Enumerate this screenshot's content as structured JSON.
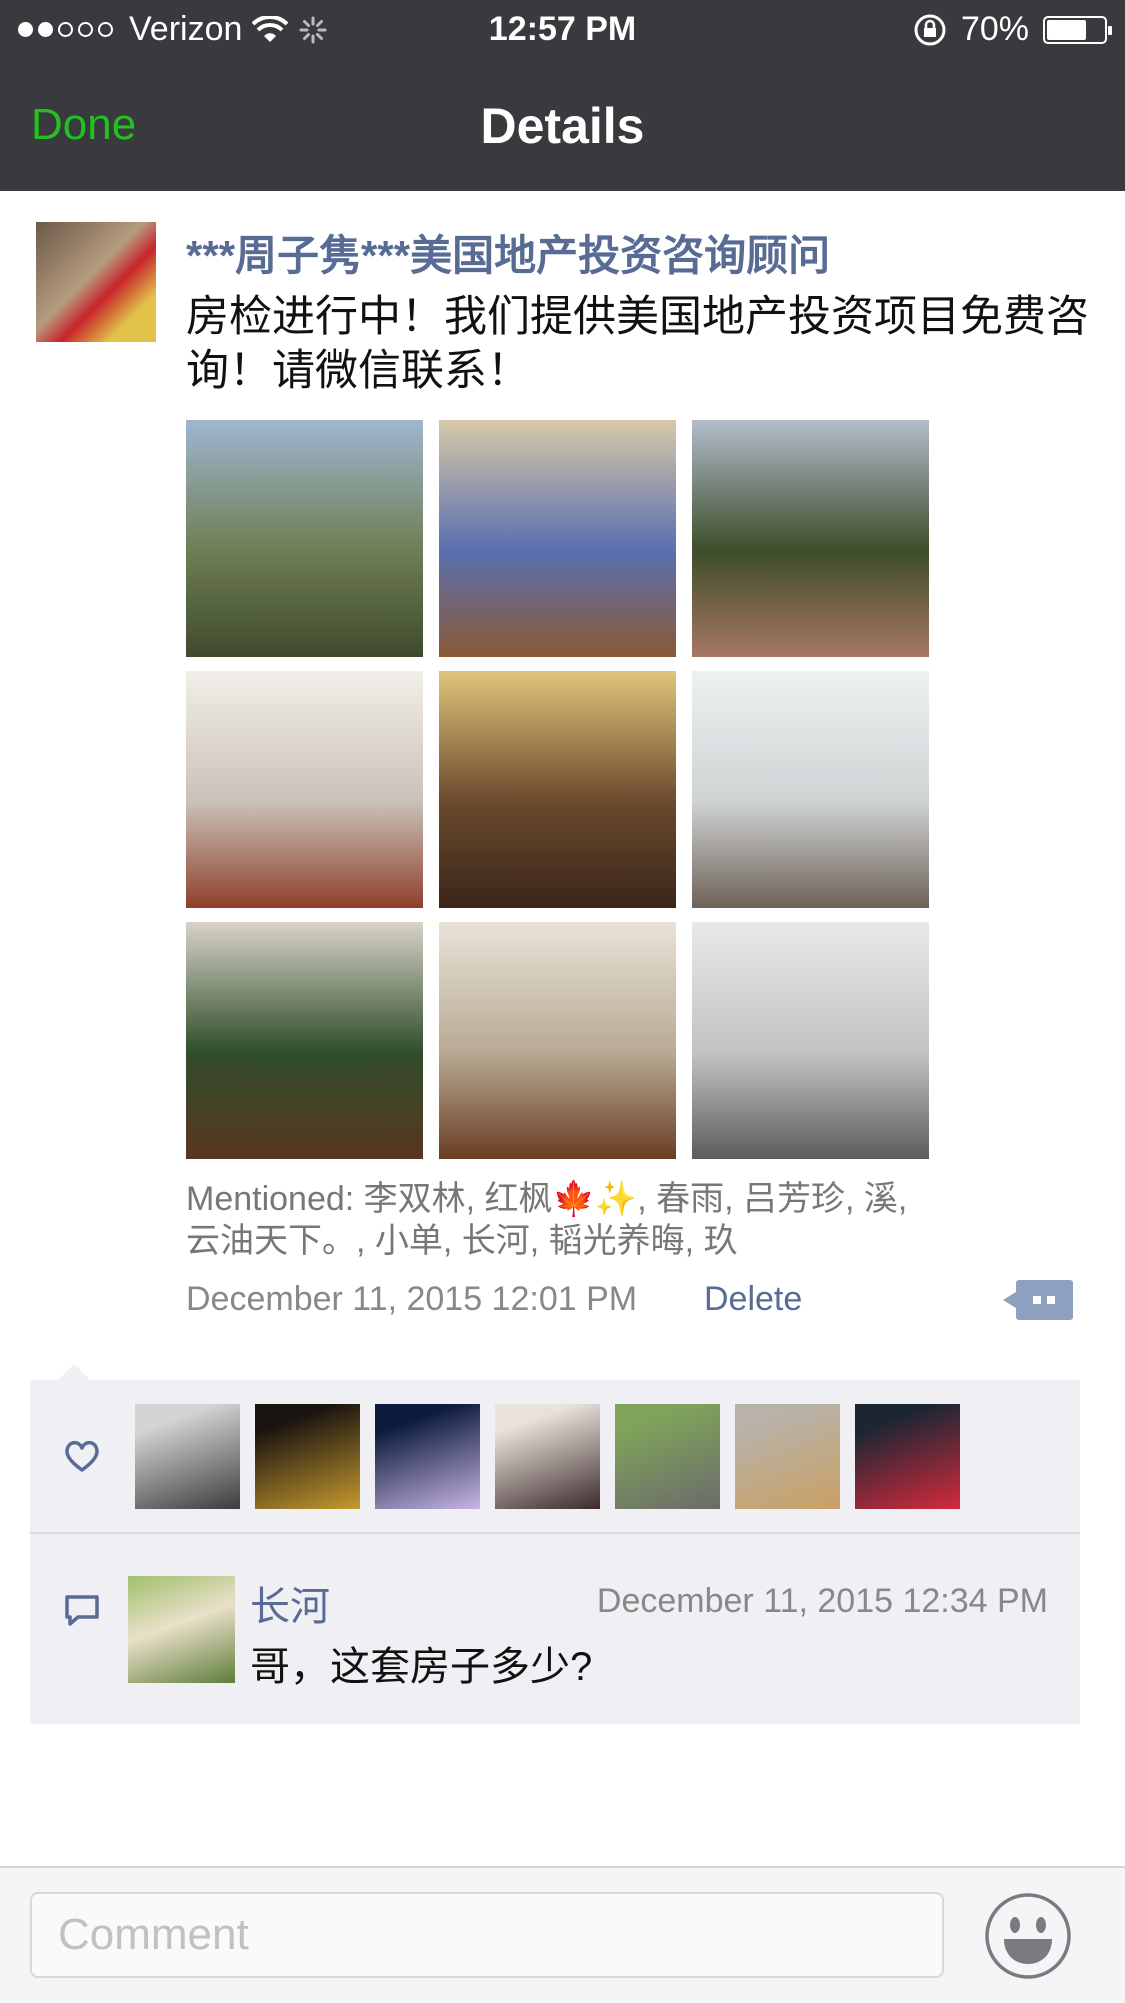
{
  "status_bar": {
    "carrier": "Verizon",
    "time": "12:57 PM",
    "battery": "70%",
    "battery_level": 0.7
  },
  "nav": {
    "done_label": "Done",
    "title": "Details"
  },
  "post": {
    "author": "***周子隽***美国地产投资咨询顾问",
    "text": "房检进行中！我们提供美国地产投资项目免费咨询！请微信联系！",
    "photos": [
      {
        "subject": "house exterior",
        "colors": [
          "#9fb6cf",
          "#6f7e55",
          "#3f4a2c"
        ]
      },
      {
        "subject": "inspector at counter",
        "colors": [
          "#d7c9a8",
          "#5a6fb0",
          "#8a5a35"
        ]
      },
      {
        "subject": "backyard patio",
        "colors": [
          "#b3bccb",
          "#3e4d2b",
          "#a77762"
        ]
      },
      {
        "subject": "staircase",
        "colors": [
          "#f2eee9",
          "#c9c2b8",
          "#8f3f2c"
        ]
      },
      {
        "subject": "kitchen with ladder",
        "colors": [
          "#e0c57a",
          "#6b4a2e",
          "#3a2618"
        ]
      },
      {
        "subject": "living room sofa",
        "colors": [
          "#eef1f2",
          "#cfd3d4",
          "#6e6258"
        ]
      },
      {
        "subject": "christmas tree room",
        "colors": [
          "#d9d3c8",
          "#2f4d2a",
          "#5b3520"
        ]
      },
      {
        "subject": "dining room ladder",
        "colors": [
          "#e9e3d8",
          "#b8aa94",
          "#6a3d22"
        ]
      },
      {
        "subject": "sunroom",
        "colors": [
          "#e6e8ea",
          "#c2c4c3",
          "#5d5c5c"
        ]
      }
    ],
    "mentions": "Mentioned: 李双林, 红枫🍁✨, 春雨, 吕芳珍, 溪, 云油天下。, 小单, 长河, 韬光养晦, 玖",
    "timestamp": "December 11, 2015 12:01 PM",
    "delete_label": "Delete"
  },
  "likes": {
    "icon": "heart-icon",
    "avatars": [
      {
        "subject": "man with cap",
        "colors": [
          "#d4d4d4",
          "#3c3c3c"
        ]
      },
      {
        "subject": "golden buddha",
        "colors": [
          "#1a1410",
          "#c79a2f"
        ]
      },
      {
        "subject": "cartoon bunny",
        "colors": [
          "#0b1a3d",
          "#c8b5e4"
        ]
      },
      {
        "subject": "couple selfie",
        "colors": [
          "#e9e2dc",
          "#3b2a2a"
        ]
      },
      {
        "subject": "woman on road",
        "colors": [
          "#7fa35a",
          "#6b6b6b"
        ]
      },
      {
        "subject": "golden retriever",
        "colors": [
          "#b8b2a8",
          "#c9a063"
        ]
      },
      {
        "subject": "red toy on screen",
        "colors": [
          "#1c2633",
          "#d42a3c"
        ]
      }
    ]
  },
  "comments": [
    {
      "name": "长河",
      "time": "December 11, 2015 12:34 PM",
      "text": "哥，这套房子多少?"
    }
  ],
  "compose": {
    "placeholder": "Comment",
    "emoji_icon": "smiley-icon"
  }
}
